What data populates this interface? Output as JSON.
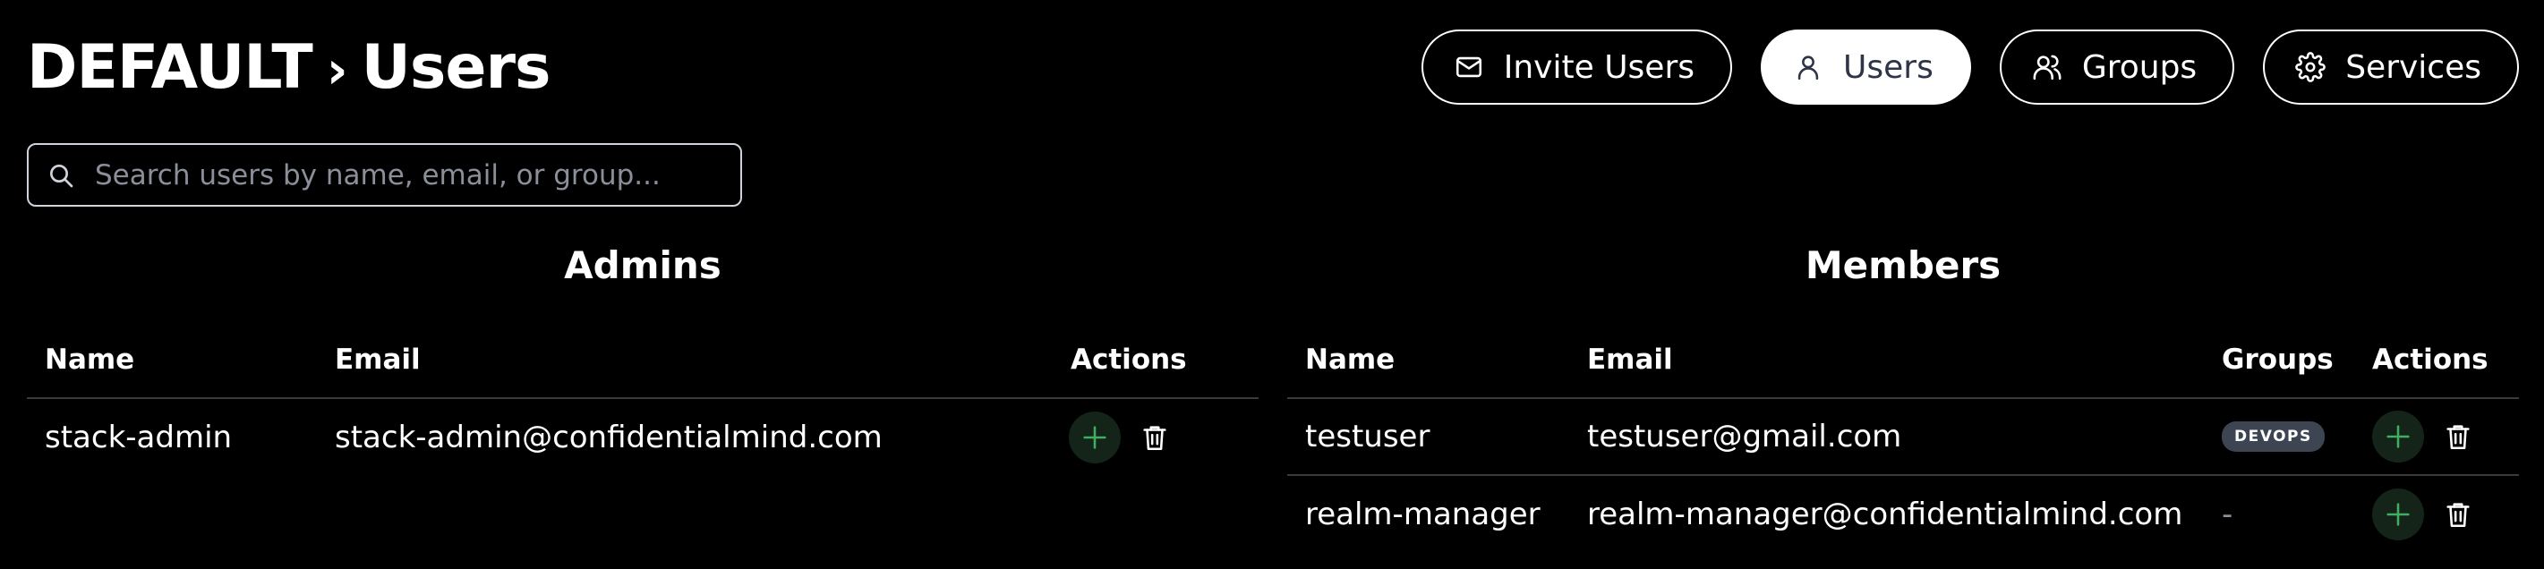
{
  "header": {
    "breadcrumb_root": "DEFAULT",
    "breadcrumb_separator": "›",
    "breadcrumb_current": "Users"
  },
  "nav": {
    "invite_users": "Invite Users",
    "users": "Users",
    "groups": "Groups",
    "services": "Services",
    "active": "users"
  },
  "search": {
    "placeholder": "Search users by name, email, or group...",
    "value": ""
  },
  "admins": {
    "title": "Admins",
    "columns": {
      "name": "Name",
      "email": "Email",
      "actions": "Actions"
    },
    "rows": [
      {
        "name": "stack-admin",
        "email": "stack-admin@confidentialmind.com"
      }
    ]
  },
  "members": {
    "title": "Members",
    "columns": {
      "name": "Name",
      "email": "Email",
      "groups": "Groups",
      "actions": "Actions"
    },
    "rows": [
      {
        "name": "testuser",
        "email": "testuser@gmail.com",
        "groups": "DEVOPS"
      },
      {
        "name": "realm-manager",
        "email": "realm-manager@confidentialmind.com",
        "groups": "-"
      }
    ]
  },
  "colors": {
    "background": "#000000",
    "text": "#ffffff",
    "active_button_text": "#2f3548",
    "badge": "#3d4452",
    "add_button_bg": "#142418",
    "add_icon": "#3fae62",
    "divider": "#3a3a3a"
  },
  "icons": {
    "invite": "mail-icon",
    "users": "user-icon",
    "groups": "users-group-icon",
    "services": "gear-icon",
    "search": "search-icon",
    "add": "plus-icon",
    "delete": "trash-icon"
  }
}
